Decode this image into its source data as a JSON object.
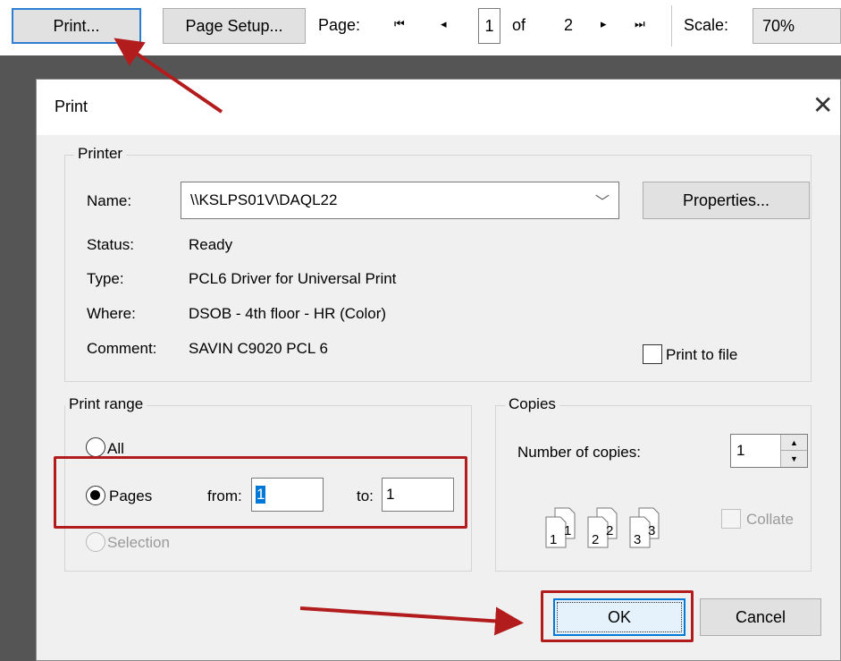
{
  "toolbar": {
    "print_btn": "Print...",
    "page_setup_btn": "Page Setup...",
    "page_label": "Page:",
    "current_page": "1",
    "of_label": "of",
    "total_pages": "2",
    "scale_label": "Scale:",
    "scale_value": "70%"
  },
  "dialog": {
    "title": "Print",
    "printer": {
      "group_label": "Printer",
      "name_label": "Name:",
      "name_value": "\\\\KSLPS01V\\DAQL22",
      "properties_btn": "Properties...",
      "status_label": "Status:",
      "status_value": "Ready",
      "type_label": "Type:",
      "type_value": "PCL6 Driver for Universal Print",
      "where_label": "Where:",
      "where_value": "DSOB - 4th floor - HR  (Color)",
      "comment_label": "Comment:",
      "comment_value": "SAVIN C9020 PCL 6",
      "print_to_file": "Print to file"
    },
    "print_range": {
      "group_label": "Print range",
      "all": "All",
      "pages": "Pages",
      "from_label": "from:",
      "from_value": "1",
      "to_label": "to:",
      "to_value": "1",
      "selection": "Selection"
    },
    "copies": {
      "group_label": "Copies",
      "number_label": "Number of copies:",
      "number_value": "1",
      "collate": "Collate"
    },
    "ok_btn": "OK",
    "cancel_btn": "Cancel"
  },
  "colors": {
    "annotation": "#b31c1c",
    "focus_blue": "#0078d7"
  }
}
